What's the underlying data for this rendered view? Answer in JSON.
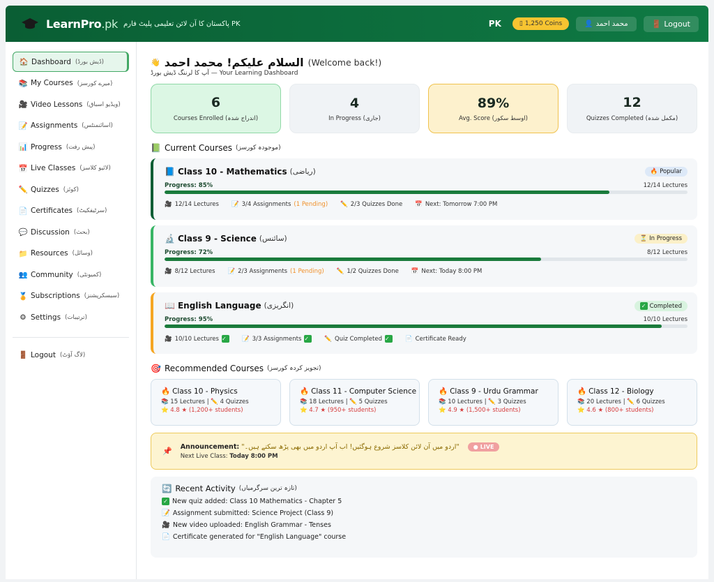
{
  "header": {
    "brand_name": "LearnPro",
    "brand_suffix": ".pk",
    "tagline": "پاکستان کا آن لائن تعلیمی پلیٹ فارم PK",
    "country": "PK",
    "coins": "1,250 Coins",
    "user_name": "محمد احمد",
    "logout": "Logout",
    "colors": {
      "primary": "#0d6b3c",
      "coins": "#f7c431"
    }
  },
  "sidebar": {
    "items": [
      {
        "label": "Dashboard",
        "sub": "(ڈیش بورڈ)",
        "icon": "home-icon"
      },
      {
        "label": "My Courses",
        "sub": "(میرے کورسز)",
        "icon": "books-icon"
      },
      {
        "label": "Video Lessons",
        "sub": "(ویڈیو اسباق)",
        "icon": "video-icon"
      },
      {
        "label": "Assignments",
        "sub": "(اسائنمنٹس)",
        "icon": "memo-icon"
      },
      {
        "label": "Progress",
        "sub": "(پیش رفت)",
        "icon": "chart-icon"
      },
      {
        "label": "Live Classes",
        "sub": "(لائیو کلاسز)",
        "icon": "calendar-icon"
      },
      {
        "label": "Quizzes",
        "sub": "(کوئز)",
        "icon": "pencil-icon"
      },
      {
        "label": "Certificates",
        "sub": "(سرٹیفکیٹ)",
        "icon": "page-icon"
      },
      {
        "label": "Discussion",
        "sub": "(بحث)",
        "icon": "speech-icon"
      },
      {
        "label": "Resources",
        "sub": "(وسائل)",
        "icon": "folder-icon"
      },
      {
        "label": "Community",
        "sub": "(کمیونٹی)",
        "icon": "people-icon"
      },
      {
        "label": "Subscriptions",
        "sub": "(سبسکرپشنز)",
        "icon": "medal-icon"
      },
      {
        "label": "Settings",
        "sub": "(ترتیبات)",
        "icon": "gear-icon"
      }
    ],
    "logout": {
      "label": "Logout",
      "sub": "(لاگ آؤٹ)"
    }
  },
  "welcome": {
    "greeting": "السلام علیکم! محمد احمد",
    "english": "(Welcome back!)",
    "subtitle": "آپ کا لرننگ ڈیش بورڈ — Your Learning Dashboard"
  },
  "stats": [
    {
      "value": "6",
      "label": "Courses Enrolled (اندراج شدہ)"
    },
    {
      "value": "4",
      "label": "In Progress (جاری)"
    },
    {
      "value": "89%",
      "label": "Avg. Score (اوسط سکور)"
    },
    {
      "value": "12",
      "label": "Quizzes Completed (مکمل شدہ)"
    }
  ],
  "current_courses": {
    "title": "Current Courses",
    "title_ur": "(موجودہ کورسز)",
    "items": [
      {
        "name": "Class 10 - Mathematics",
        "name_ur": "(ریاضی)",
        "badge": "Popular",
        "progress_label": "Progress: 85%",
        "progress": 0.85,
        "lectures_right": "12/14 Lectures",
        "lectures": "12/14 Lectures",
        "assignments": "3/4 Assignments",
        "pending": "(1 Pending)",
        "quizzes": "2/3 Quizzes Done",
        "next": "Next: Tomorrow 7:00 PM"
      },
      {
        "name": "Class 9 - Science",
        "name_ur": "(سائنس)",
        "badge": "In Progress",
        "progress_label": "Progress: 72%",
        "progress": 0.72,
        "lectures_right": "8/12 Lectures",
        "lectures": "8/12 Lectures",
        "assignments": "2/3 Assignments",
        "pending": "(1 Pending)",
        "quizzes": "1/2 Quizzes Done",
        "next": "Next: Today 8:00 PM"
      },
      {
        "name": "English Language",
        "name_ur": "(انگریزی)",
        "badge": "Completed",
        "progress_label": "Progress: 95%",
        "progress": 0.95,
        "lectures_right": "10/10 Lectures",
        "lectures": "10/10 Lectures",
        "assignments": "3/3 Assignments",
        "quizzes": "Quiz Completed",
        "next": "Certificate Ready"
      }
    ]
  },
  "recommended": {
    "title": "Recommended Courses",
    "title_ur": "(تجویز کردہ کورسز)",
    "items": [
      {
        "name": "Class 10 - Physics",
        "lectures": "15 Lectures",
        "quizzes": "4 Quizzes",
        "rating": "4.8 ★ (1,200+ students)"
      },
      {
        "name": "Class 11 - Computer Science",
        "lectures": "18 Lectures",
        "quizzes": "5 Quizzes",
        "rating": "4.7 ★ (950+ students)"
      },
      {
        "name": "Class 9 - Urdu Grammar",
        "lectures": "10 Lectures",
        "quizzes": "3 Quizzes",
        "rating": "4.9 ★ (1,500+ students)"
      },
      {
        "name": "Class 12 - Biology",
        "lectures": "20 Lectures",
        "quizzes": "6 Quizzes",
        "rating": "4.6 ★ (800+ students)"
      }
    ]
  },
  "announcement": {
    "label": "Announcement:",
    "text": "\"اردو میں آن لائن کلاسز شروع ہوگئیں! اب آپ اردو میں بھی پڑھ سکتے ہیں۔\"",
    "next_label": "Next Live Class:",
    "next_value": "Today 8:00 PM",
    "live": "LIVE"
  },
  "activity": {
    "title": "Recent Activity",
    "title_ur": "(تازہ ترین سرگرمیاں)",
    "items": [
      "New quiz added: Class 10 Mathematics - Chapter 5",
      "Assignment submitted: Science Project (Class 9)",
      "New video uploaded: English Grammar - Tenses",
      "Certificate generated for \"English Language\" course"
    ]
  }
}
